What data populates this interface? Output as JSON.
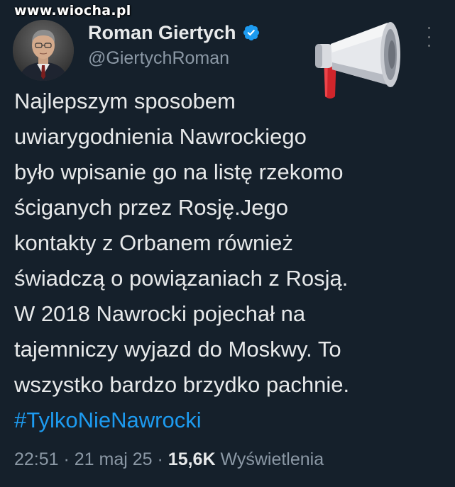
{
  "watermark": "www.wiocha.pl",
  "author": {
    "display_name": "Roman Giertych",
    "handle": "@GiertychRoman"
  },
  "tweet": {
    "lines": [
      "Najlepszym sposobem",
      "uwiarygodnienia Nawrockiego",
      "było wpisanie go na listę rzekomo",
      "ściganych przez Rosję.Jego",
      "kontakty z Orbanem również",
      "świadczą o powiązaniach z Rosją.",
      "W 2018 Nawrocki pojechał na",
      "tajemniczy wyjazd do Moskwy. To",
      "wszystko bardzo brzydko pachnie."
    ],
    "hashtag": "#TylkoNieNawrocki"
  },
  "meta": {
    "time": "22:51",
    "separator_1": " · ",
    "date": "21 maj 25",
    "separator_2": " · ",
    "views_count": "15,6K",
    "views_label": " Wyświetlenia"
  },
  "colors": {
    "background": "#15202b",
    "text": "#e7e9ea",
    "secondary_text": "#8b98a5",
    "accent": "#1d9bf0",
    "verified": "#1d9bf0"
  },
  "icons": {
    "verified": "verified-badge-icon",
    "more": "more-options-icon",
    "sticker": "megaphone-icon"
  }
}
